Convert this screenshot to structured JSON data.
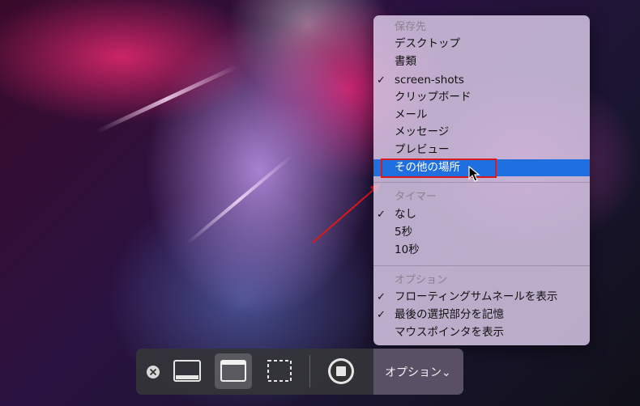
{
  "menu": {
    "save_to": {
      "header": "保存先",
      "items": [
        {
          "label": "デスクトップ",
          "checked": false
        },
        {
          "label": "書類",
          "checked": false
        },
        {
          "label": "screen-shots",
          "checked": true
        },
        {
          "label": "クリップボード",
          "checked": false
        },
        {
          "label": "メール",
          "checked": false
        },
        {
          "label": "メッセージ",
          "checked": false
        },
        {
          "label": "プレビュー",
          "checked": false
        },
        {
          "label": "その他の場所",
          "checked": false,
          "highlighted": true
        }
      ]
    },
    "timer": {
      "header": "タイマー",
      "items": [
        {
          "label": "なし",
          "checked": true
        },
        {
          "label": "5秒",
          "checked": false
        },
        {
          "label": "10秒",
          "checked": false
        }
      ]
    },
    "options": {
      "header": "オプション",
      "items": [
        {
          "label": "フローティングサムネールを表示",
          "checked": true
        },
        {
          "label": "最後の選択部分を記憶",
          "checked": true
        },
        {
          "label": "マウスポインタを表示",
          "checked": false
        }
      ]
    },
    "check_glyph": "✓"
  },
  "toolbar": {
    "close_icon": "close-icon",
    "buttons": [
      "capture-entire-screen",
      "capture-selected-window",
      "capture-selected-portion",
      "record-screen"
    ],
    "options_label": "オプション",
    "options_chevron": "⌄"
  },
  "colors": {
    "highlight": "#1f6fe0",
    "annotation": "#d81a1a"
  }
}
